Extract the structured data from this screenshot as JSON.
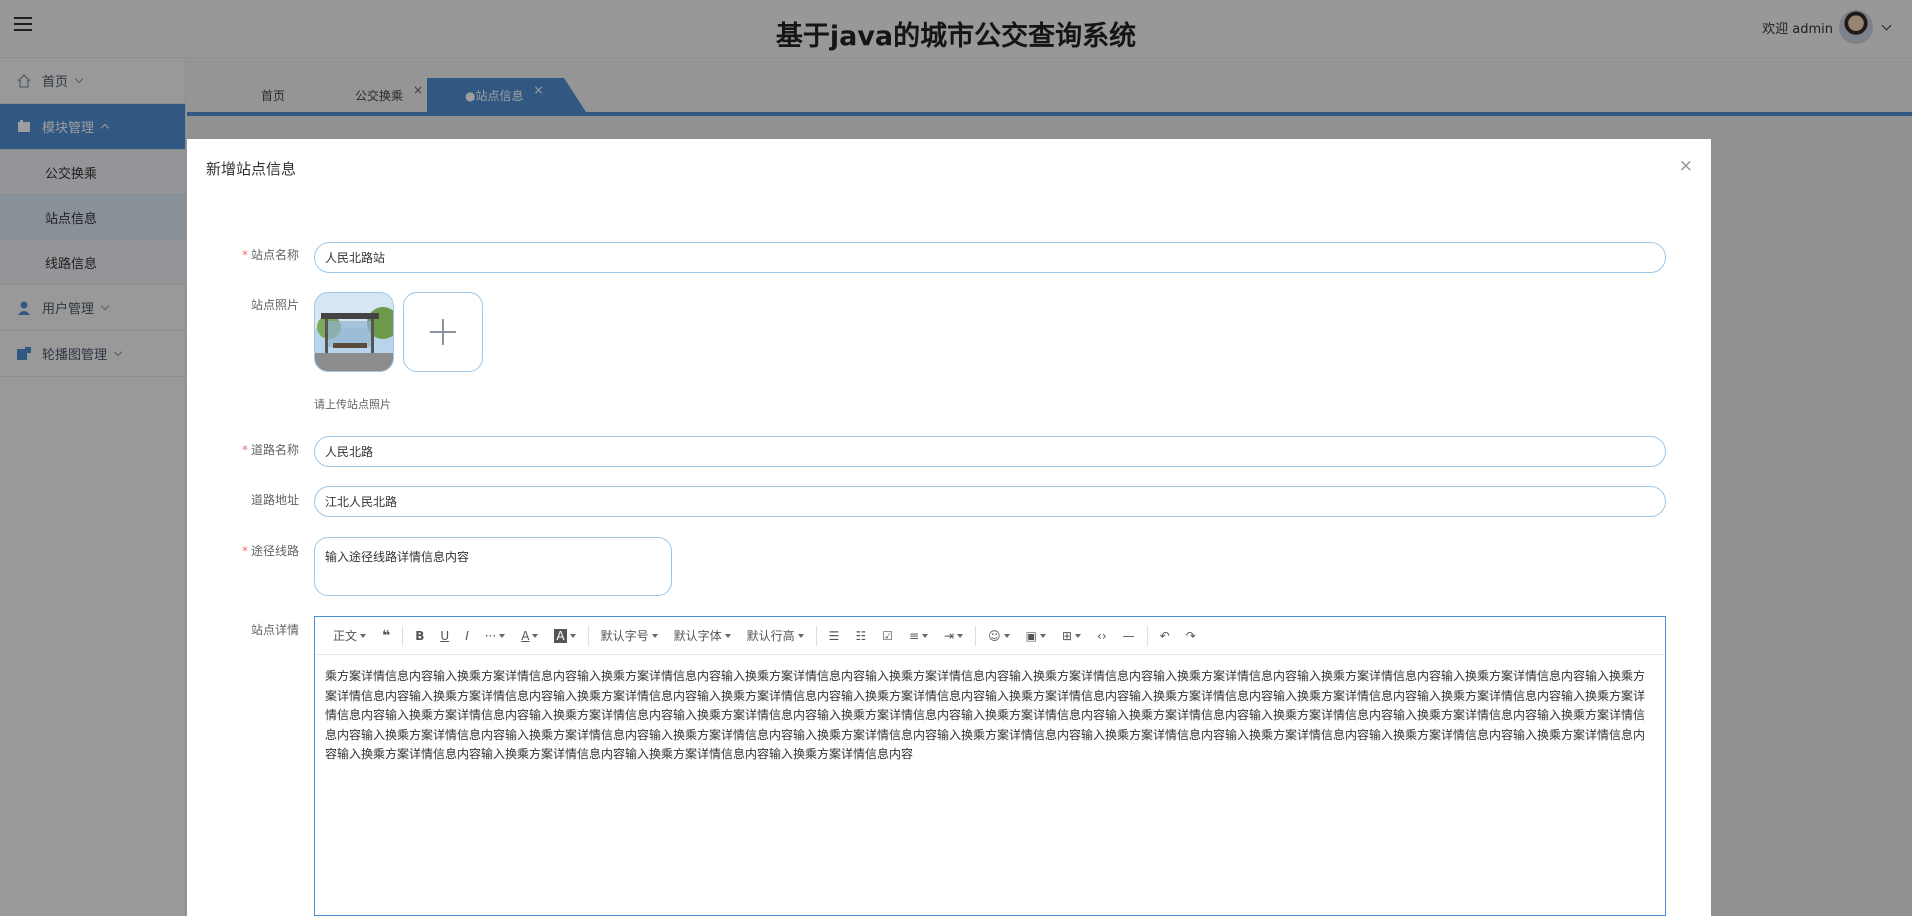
{
  "header": {
    "title": "基于java的城市公交查询系统",
    "welcome": "欢迎 admin"
  },
  "sidebar": {
    "items": [
      {
        "label": "首页",
        "icon": "home-icon"
      },
      {
        "label": "模块管理",
        "icon": "module-icon",
        "children": [
          "公交换乘",
          "站点信息",
          "线路信息"
        ]
      },
      {
        "label": "用户管理",
        "icon": "user-icon"
      },
      {
        "label": "轮播图管理",
        "icon": "carousel-icon"
      }
    ]
  },
  "tabs": [
    {
      "label": "首页"
    },
    {
      "label": "公交换乘",
      "close": "×"
    },
    {
      "label": "●站点信息",
      "close": "×"
    }
  ],
  "modal": {
    "title": "新增站点信息",
    "close": "×",
    "fields": {
      "station_name": {
        "label": "站点名称",
        "value": "人民北路站"
      },
      "station_photo": {
        "label": "站点照片",
        "tip": "请上传站点照片"
      },
      "road_name": {
        "label": "道路名称",
        "value": "人民北路"
      },
      "road_address": {
        "label": "道路地址",
        "value": "江北人民北路"
      },
      "route": {
        "label": "途径线路",
        "value": "输入途径线路详情信息内容"
      },
      "detail": {
        "label": "站点详情"
      }
    },
    "editor": {
      "toolbar": {
        "paragraph": "正文",
        "quote": "❝",
        "bold": "B",
        "underline": "U",
        "italic": "I",
        "more": "···",
        "font_color": "A",
        "bg_color": "A",
        "font_size": "默认字号",
        "font_family": "默认字体",
        "line_height": "默认行高",
        "bullet_list": "☰",
        "numbered_list": "☷",
        "todo": "☑",
        "align": "≡",
        "indent": "⇥",
        "emoji": "☺",
        "image": "▣",
        "table": "⊞",
        "code": "‹›",
        "divider": "—",
        "undo": "↶",
        "redo": "↷"
      },
      "content": "乘方案详情信息内容输入换乘方案详情信息内容输入换乘方案详情信息内容输入换乘方案详情信息内容输入换乘方案详情信息内容输入换乘方案详情信息内容输入换乘方案详情信息内容输入换乘方案详情信息内容输入换乘方案详情信息内容输入换乘方案详情信息内容输入换乘方案详情信息内容输入换乘方案详情信息内容输入换乘方案详情信息内容输入换乘方案详情信息内容输入换乘方案详情信息内容输入换乘方案详情信息内容输入换乘方案详情信息内容输入换乘方案详情信息内容输入换乘方案详情信息内容输入换乘方案详情信息内容输入换乘方案详情信息内容输入换乘方案详情信息内容输入换乘方案详情信息内容输入换乘方案详情信息内容输入换乘方案详情信息内容输入换乘方案详情信息内容输入换乘方案详情信息内容输入换乘方案详情信息内容输入换乘方案详情信息内容输入换乘方案详情信息内容输入换乘方案详情信息内容输入换乘方案详情信息内容输入换乘方案详情信息内容输入换乘方案详情信息内容输入换乘方案详情信息内容输入换乘方案详情信息内容输入换乘方案详情信息内容输入换乘方案详情信息内容输入换乘方案详情信息内容输入换乘方案详情信息内容输入换乘方案详情信息内容"
    }
  },
  "colors": {
    "accent": "#4e8fd3",
    "required": "#f56c6c"
  }
}
